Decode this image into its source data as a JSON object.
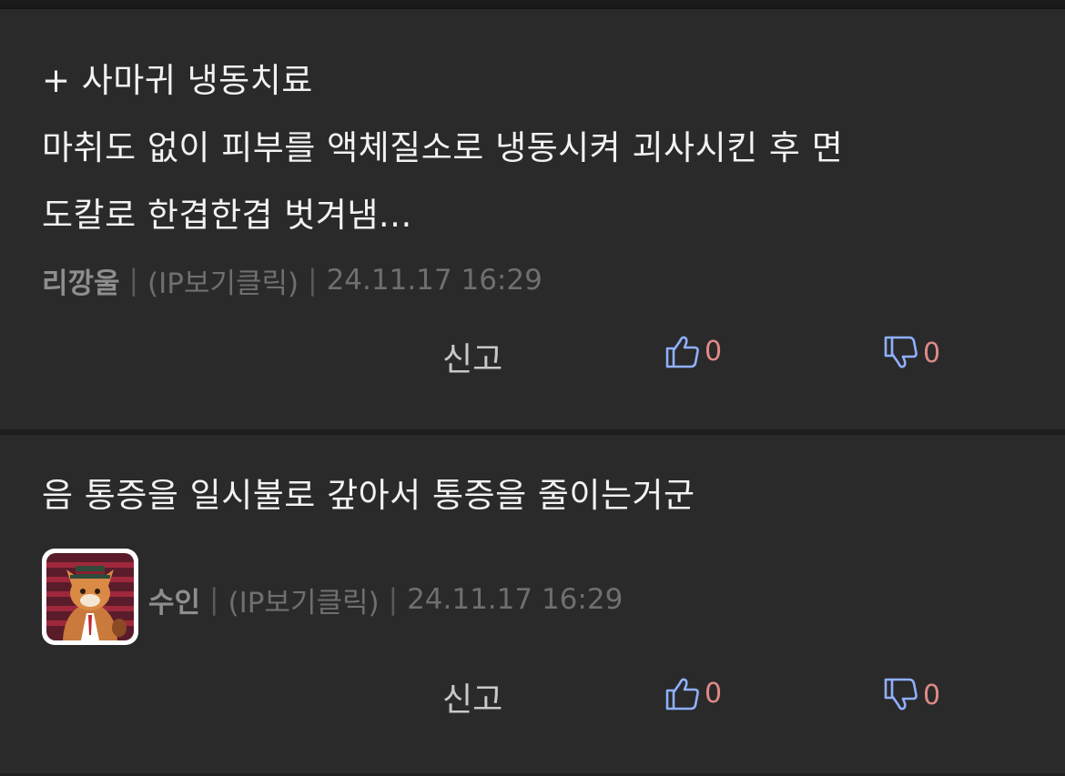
{
  "comments": [
    {
      "body": [
        "+ 사마귀 냉동치료",
        "마취도 없이 피부를 액체질소로 냉동시켜 괴사시킨 후 면",
        "도칼로 한겹한겹 벗겨냄..."
      ],
      "nickname": "리깡울",
      "ip_label": "(IP보기클릭)",
      "timestamp": "24.11.17 16:29",
      "report_label": "신고",
      "likes": "0",
      "dislikes": "0",
      "has_avatar": false
    },
    {
      "body": [
        "음 통증을 일시불로 갚아서 통증을 줄이는거군"
      ],
      "nickname": "수인",
      "ip_label": "(IP보기클릭)",
      "timestamp": "24.11.17 16:29",
      "report_label": "신고",
      "likes": "0",
      "dislikes": "0",
      "has_avatar": true
    }
  ],
  "separator": "|",
  "colors": {
    "background": "#2a2a2b",
    "divider": "#1e1e1f",
    "text": "#f2f2f2",
    "meta": "#6f6f70",
    "count": "#e08a86",
    "thumb_icon": "#8fb0ff"
  },
  "icons": {
    "like": "thumbs-up-icon",
    "dislike": "thumbs-down-icon"
  }
}
